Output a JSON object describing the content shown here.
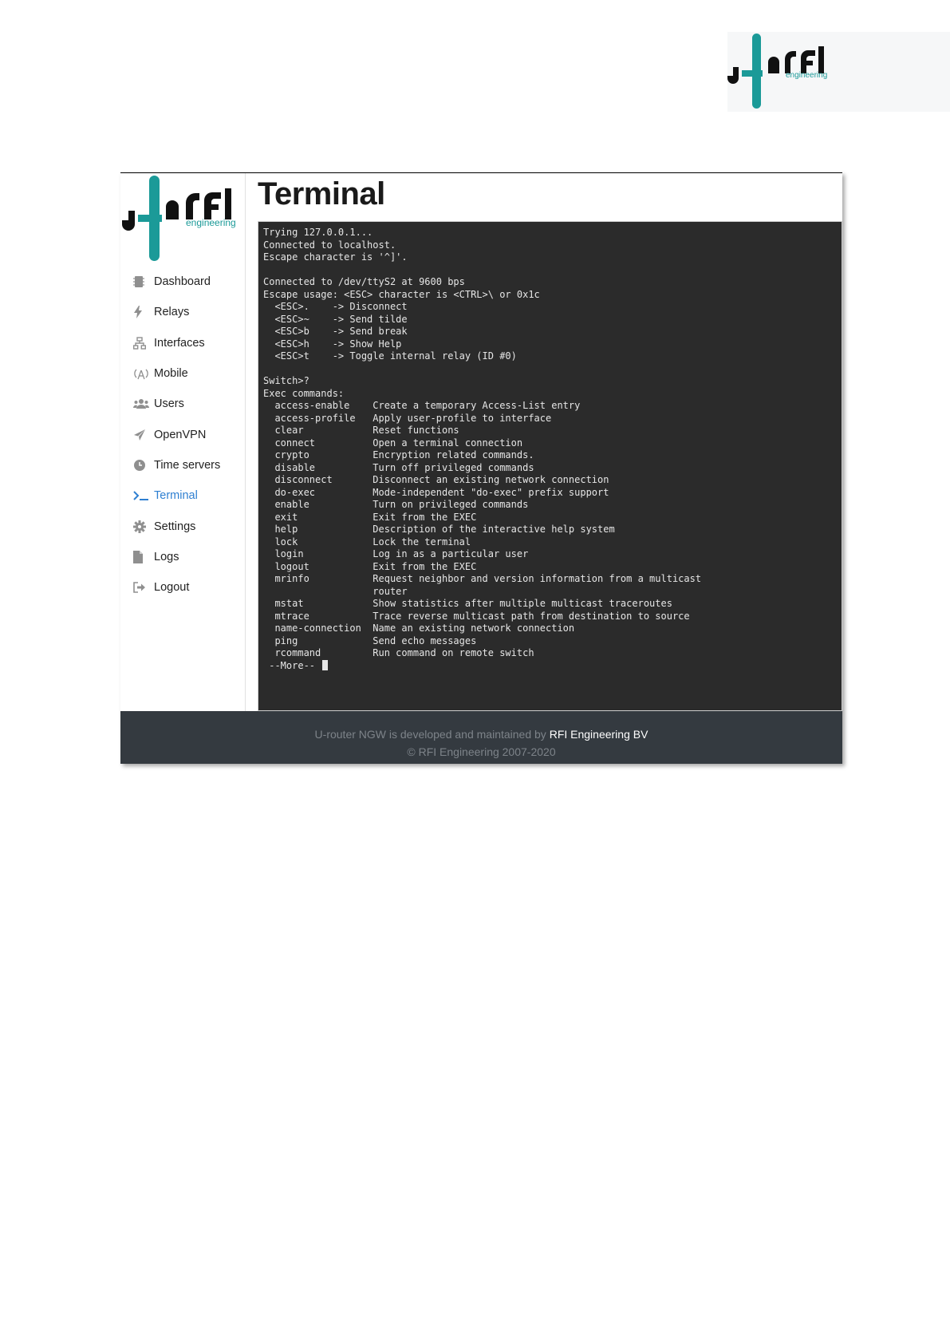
{
  "brand": {
    "name": "rfi",
    "tagline": "engineering",
    "colors": {
      "teal": "#1b9a98",
      "dark": "#111111"
    }
  },
  "sidebar": {
    "items": [
      {
        "label": "Dashboard",
        "icon": "chip-icon"
      },
      {
        "label": "Relays",
        "icon": "bolt-icon"
      },
      {
        "label": "Interfaces",
        "icon": "network-icon"
      },
      {
        "label": "Mobile",
        "icon": "antenna-icon"
      },
      {
        "label": "Users",
        "icon": "users-icon"
      },
      {
        "label": "OpenVPN",
        "icon": "paper-plane-icon"
      },
      {
        "label": "Time servers",
        "icon": "clock-icon"
      },
      {
        "label": "Terminal",
        "icon": "terminal-icon",
        "active": true
      },
      {
        "label": "Settings",
        "icon": "gear-icon"
      },
      {
        "label": "Logs",
        "icon": "file-icon"
      },
      {
        "label": "Logout",
        "icon": "sign-out-icon"
      }
    ],
    "active_color": "#2e7fd1"
  },
  "main": {
    "title": "Terminal"
  },
  "terminal": {
    "lines": [
      "Trying 127.0.0.1...",
      "Connected to localhost.",
      "Escape character is '^]'.",
      "",
      "Connected to /dev/ttyS2 at 9600 bps",
      "Escape usage: <ESC> character is <CTRL>\\ or 0x1c",
      "  <ESC>.    -> Disconnect",
      "  <ESC>~    -> Send tilde",
      "  <ESC>b    -> Send break",
      "  <ESC>h    -> Show Help",
      "  <ESC>t    -> Toggle internal relay (ID #0)",
      "",
      "Switch>?",
      "Exec commands:",
      "  access-enable    Create a temporary Access-List entry",
      "  access-profile   Apply user-profile to interface",
      "  clear            Reset functions",
      "  connect          Open a terminal connection",
      "  crypto           Encryption related commands.",
      "  disable          Turn off privileged commands",
      "  disconnect       Disconnect an existing network connection",
      "  do-exec          Mode-independent \"do-exec\" prefix support",
      "  enable           Turn on privileged commands",
      "  exit             Exit from the EXEC",
      "  help             Description of the interactive help system",
      "  lock             Lock the terminal",
      "  login            Log in as a particular user",
      "  logout           Exit from the EXEC",
      "  mrinfo           Request neighbor and version information from a multicast",
      "                   router",
      "  mstat            Show statistics after multiple multicast traceroutes",
      "  mtrace           Trace reverse multicast path from destination to source",
      "  name-connection  Name an existing network connection",
      "  ping             Send echo messages",
      "  rcommand         Run command on remote switch",
      " --More-- "
    ],
    "background": "#2b2b2b"
  },
  "footer": {
    "text_prefix": "U-router NGW is developed and maintained by ",
    "link_text": "RFI Engineering BV",
    "copyright": "© RFI Engineering 2007-2020"
  }
}
